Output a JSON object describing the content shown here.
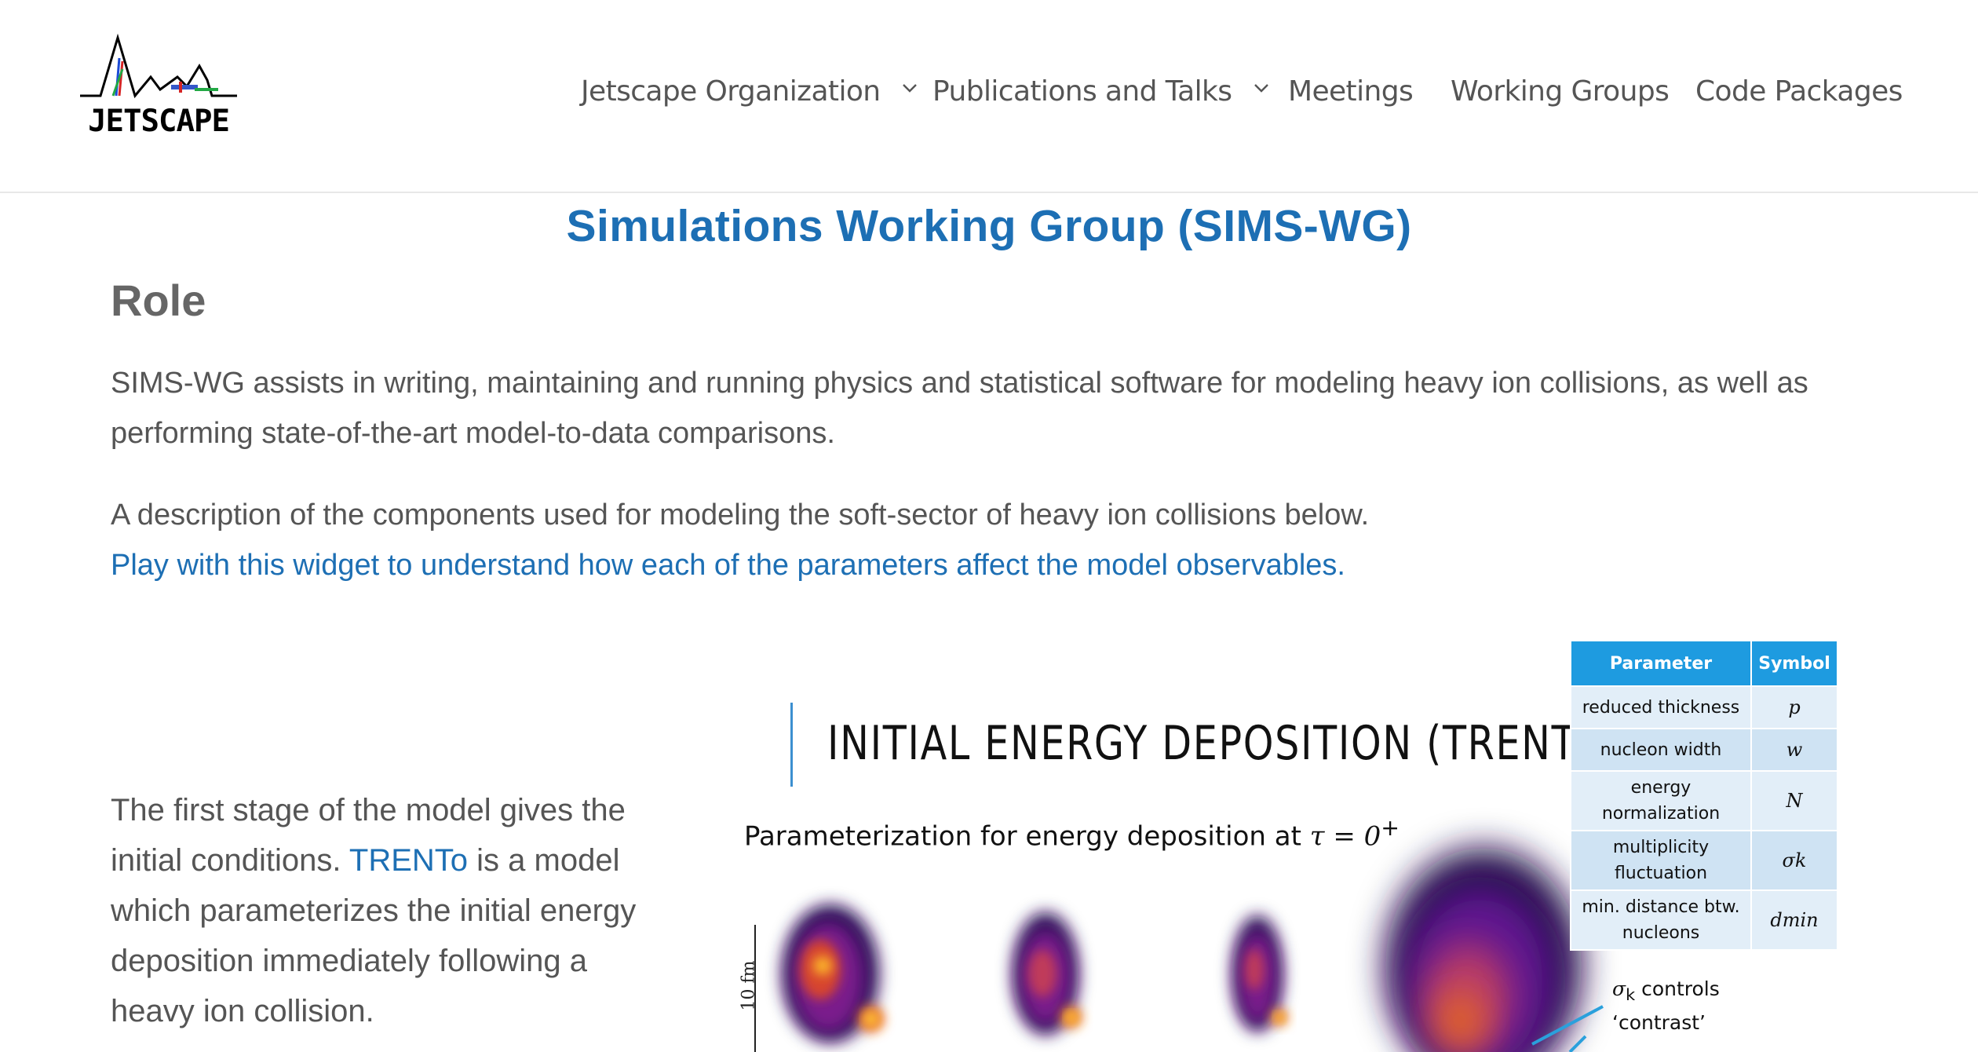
{
  "header": {
    "logo_text": "JETSCAPE",
    "nav": [
      {
        "label": "Jetscape Organization",
        "has_dropdown": true
      },
      {
        "label": "Publications and Talks",
        "has_dropdown": true
      },
      {
        "label": "Meetings",
        "has_dropdown": false
      },
      {
        "label": "Working Groups",
        "has_dropdown": false
      },
      {
        "label": "Code Packages",
        "has_dropdown": false
      }
    ]
  },
  "main": {
    "title": "Simulations Working Group (SIMS-WG)",
    "role_heading": "Role",
    "role_text": "SIMS-WG assists in writing, maintaining and running physics and statistical software for modeling heavy ion collisions, as well as performing state-of-the-art model-to-data comparisons.",
    "description_text": "A description of the components used for modeling the soft-sector of heavy ion collisions below.",
    "widget_link": "Play with this widget to understand how each of the parameters affect the model observables.",
    "stage_text_before": "The first stage of the model gives the initial conditions.",
    "stage_link": "TRENTo",
    "stage_text_after": "is a model which parameterizes the initial energy deposition immediately following a heavy ion collision."
  },
  "slide": {
    "title": "INITIAL ENERGY DEPOSITION (TRENTO)",
    "subtitle_prefix": "Parameterization for energy deposition at ",
    "subtitle_math": "τ = 0",
    "subtitle_sup": "+",
    "scale_label": "10 fm",
    "annotation_symbol": "σ",
    "annotation_sub": "k",
    "annotation_text": " controls",
    "annotation_line2": "‘contrast’"
  },
  "param_table": {
    "headers": [
      "Parameter",
      "Symbol"
    ],
    "rows": [
      {
        "parameter": "reduced thickness",
        "symbol": "p"
      },
      {
        "parameter": "nucleon width",
        "symbol": "w"
      },
      {
        "parameter": "energy normalization",
        "symbol": "N"
      },
      {
        "parameter": "multiplicity fluctuation",
        "symbol": "σk"
      },
      {
        "parameter": "min. distance btw. nucleons",
        "symbol": "dmin"
      }
    ]
  },
  "colors": {
    "accent": "#1d6fb4",
    "text": "#555555",
    "table_header": "#1e9be0",
    "table_row": "#cfe3f3"
  }
}
